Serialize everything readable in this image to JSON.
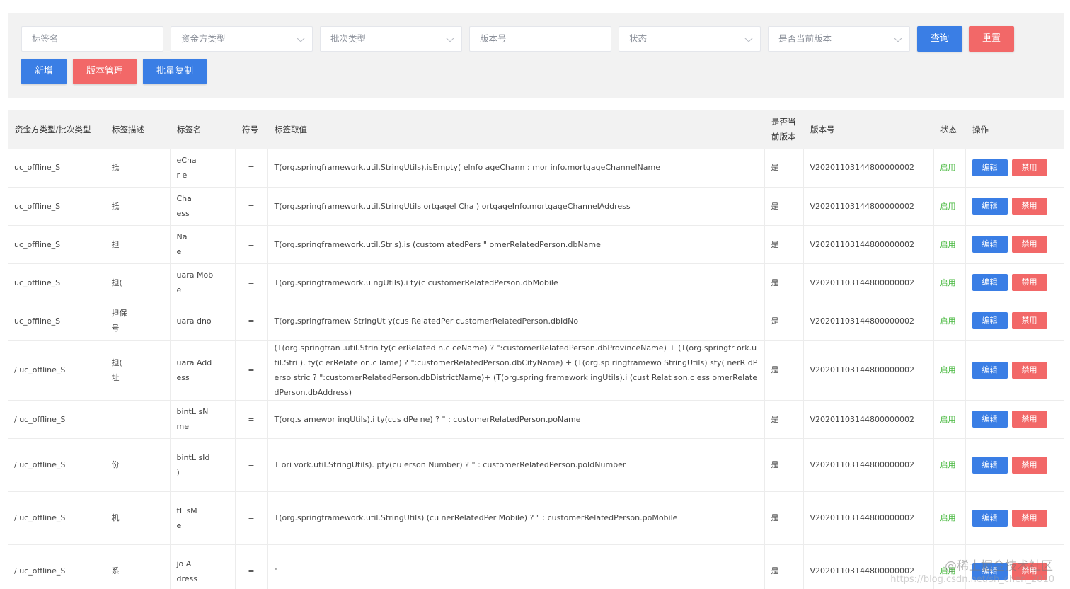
{
  "filters": {
    "tag_name": "标签名",
    "fund_type": "资金方类型",
    "batch_type": "批次类型",
    "version_no": "版本号",
    "status": "状态",
    "is_current": "是否当前版本",
    "query": "查询",
    "reset": "重置",
    "add": "新增",
    "version_manage": "版本管理",
    "batch_copy": "批量复制"
  },
  "table": {
    "headers": {
      "fund_batch": "资金方类型/批次类型",
      "desc": "标签描述",
      "name": "标签名",
      "symbol": "符号",
      "value": "标签取值",
      "current": "是否当前版本",
      "version": "版本号",
      "status": "状态",
      "ops": "操作"
    },
    "rows": [
      {
        "fund": "uc_offline_S",
        "desc": "抵",
        "name": "eCha\nr e",
        "symbol": "=",
        "value": "T(org.springframework.util.StringUtils).isEmpty( elnfo ageChann : mor info.mortgageChannelName",
        "current": "是",
        "version": "V2020110314480000000​2",
        "status": "启用",
        "edit": "编辑",
        "disable": "禁用"
      },
      {
        "fund": "uc_offline_S",
        "desc": "抵",
        "name": "Cha\ness",
        "symbol": "=",
        "value": "T(org.springframework.util.StringUtils ortgagel Cha ) ortgageInfo.mortgageChannelAddress",
        "current": "是",
        "version": "V20201103144800000002",
        "status": "启用",
        "edit": "编辑",
        "disable": "禁用"
      },
      {
        "fund": "uc_offline_S",
        "desc": "担",
        "name": "Na\ne",
        "symbol": "=",
        "value": "T(org.springframework.util.Str s).is (custom atedPers \" omerRelatedPerson.dbName",
        "current": "是",
        "version": "V20201103144800000002",
        "status": "启用",
        "edit": "编辑",
        "disable": "禁用"
      },
      {
        "fund": "uc_offline_S",
        "desc": "担(",
        "name": "uara Mob\ne",
        "symbol": "=",
        "value": "T(org.springframework.u ngUtils).i ty(c customerRelatedPerson.dbMobile",
        "current": "是",
        "version": "V20201103144800000002",
        "status": "启用",
        "edit": "编辑",
        "disable": "禁用"
      },
      {
        "fund": "uc_offline_S",
        "desc": "担保\n号",
        "name": "uara dno",
        "symbol": "=",
        "value": "T(org.springframew StringUt y(cus RelatedPer customerRelatedPerson.dbIdNo",
        "current": "是",
        "version": "V20201103144800000002",
        "status": "启用",
        "edit": "编辑",
        "disable": "禁用"
      },
      {
        "fund": "/ uc_offline_S",
        "desc": "担(\n址",
        "name": "uara Add\ness",
        "symbol": "=",
        "value": "(T(org.springfran .util.Strin ty(c erRelated n.c ceName) ? \":customerRelatedPerson.dbProvinceName) + (T(org.springfr ork.util.Stri ). ty(c erRelate on.c lame) ? \":customerRelatedPerson.dbCityName) + (T(org.sp ringframewo StringUtils) sty( nerR dPerso stric ? \":customerRelatedPerson.dbDistrictName)+ (T(org.spring framework ingUtils).i (cust Relat son.c ess omerRelatedPerson.dbAddress)",
        "current": "是",
        "version": "V20201103144800000002",
        "status": "启用",
        "edit": "编辑",
        "disable": "禁用"
      },
      {
        "fund": "/ uc_offline_S",
        "desc": "",
        "name": "bintL sN\nme",
        "symbol": "=",
        "value": "T(org.s amewor ingUtils).i ty(cus dPe ne) ? \" : customerRelatedPerson.poName",
        "current": "是",
        "version": "V20201103144800000002",
        "status": "启用",
        "edit": "编辑",
        "disable": "禁用"
      },
      {
        "fund": "/ uc_offline_S",
        "desc": "份",
        "name": "bintL sId\n)",
        "symbol": "=",
        "value": "T ori vork.util.StringUtils). pty(cu erson Number) ? \" : customerRelatedPerson.poIdNumber",
        "current": "是",
        "version": "V20201103144800000002",
        "status": "启用",
        "edit": "编辑",
        "disable": "禁用"
      },
      {
        "fund": "/ uc_offline_S",
        "desc": "机",
        "name": "tL sM\ne",
        "symbol": "=",
        "value": "T(org.springframework.util.StringUtils) (cu nerRelatedPer Mobile) ? \" : customerRelatedPerson.poMobile",
        "current": "是",
        "version": "V20201103144800000002",
        "status": "启用",
        "edit": "编辑",
        "disable": "禁用"
      },
      {
        "fund": "/ uc_offline_S",
        "desc": "系",
        "name": "jo A\ndress",
        "symbol": "=",
        "value": "\"",
        "current": "是",
        "version": "V20201103144800000002",
        "status": "启用",
        "edit": "编辑",
        "disable": "禁用"
      }
    ]
  },
  "watermark": "@稀土掘金技术社区",
  "watermark_url": "https://blog.csdn.net/sh_chen_2010"
}
